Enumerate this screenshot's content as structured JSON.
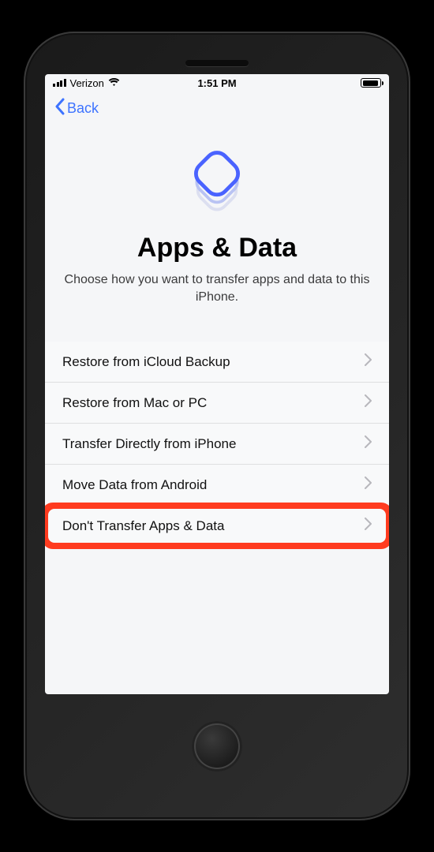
{
  "status": {
    "carrier": "Verizon",
    "time": "1:51 PM"
  },
  "nav": {
    "back_label": "Back"
  },
  "hero": {
    "title": "Apps & Data",
    "subtitle": "Choose how you want to transfer apps and data to this iPhone."
  },
  "options": [
    {
      "label": "Restore from iCloud Backup",
      "highlighted": false
    },
    {
      "label": "Restore from Mac or PC",
      "highlighted": false
    },
    {
      "label": "Transfer Directly from iPhone",
      "highlighted": false
    },
    {
      "label": "Move Data from Android",
      "highlighted": false
    },
    {
      "label": "Don't Transfer Apps & Data",
      "highlighted": true
    }
  ],
  "colors": {
    "accent_blue": "#3d73ff",
    "highlight_red": "#ff3b1f"
  }
}
